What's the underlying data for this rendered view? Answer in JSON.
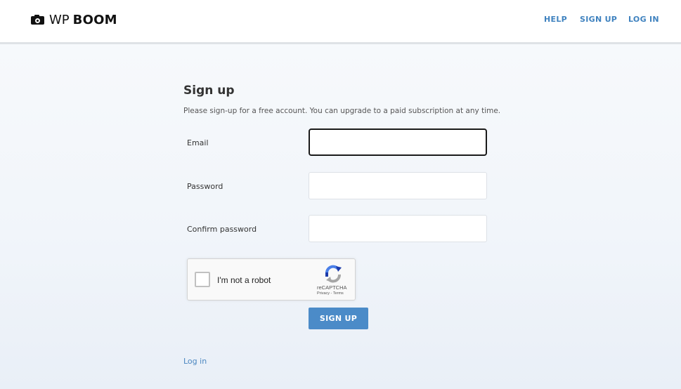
{
  "header": {
    "logo_prefix": "WP",
    "logo_brand": "BOOM",
    "nav": {
      "help": "HELP",
      "signup": "SIGN UP",
      "login": "LOG IN"
    }
  },
  "form": {
    "title": "Sign up",
    "subtitle": "Please sign-up for a free account. You can upgrade to a paid subscription at any time.",
    "email_label": "Email",
    "email_value": "",
    "password_label": "Password",
    "password_value": "",
    "confirm_label": "Confirm password",
    "confirm_value": "",
    "submit_label": "SIGN UP"
  },
  "recaptcha": {
    "label": "I'm not a robot",
    "brand": "reCAPTCHA",
    "privacy": "Privacy",
    "separator": " - ",
    "terms": "Terms",
    "checked": false
  },
  "footer": {
    "login_link": "Log in"
  },
  "colors": {
    "accent": "#4b8bc8",
    "link": "#3f82bf",
    "header_bg": "#ffffff",
    "page_bg": "#f1f5fa"
  },
  "icons": {
    "logo": "camera-icon",
    "captcha": "recaptcha-logo-icon"
  }
}
